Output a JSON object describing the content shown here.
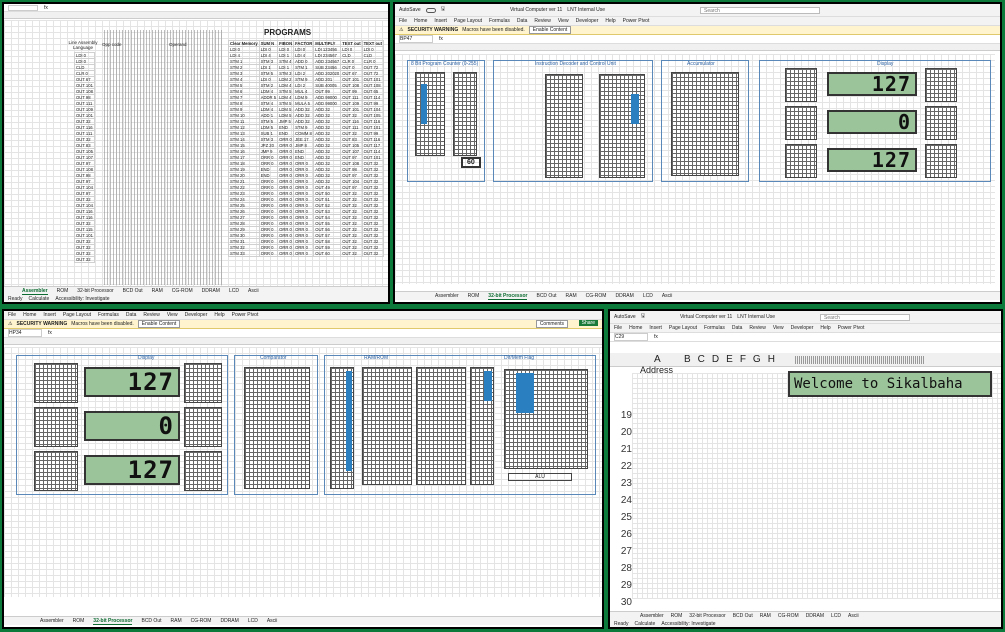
{
  "menus": [
    "File",
    "Home",
    "Insert",
    "Page Layout",
    "Formulas",
    "Data",
    "Review",
    "View",
    "Developer",
    "Help",
    "Power Pivot"
  ],
  "app_title": "Virtual Computer ver 11",
  "workbook_tag": "LNT Internal Use",
  "search_placeholder": "Search",
  "security_warning": {
    "label": "SECURITY WARNING",
    "message": "Macros have been disabled.",
    "button": "Enable Content"
  },
  "comments": "Comments",
  "share": "Share",
  "autosave": "AutoSave",
  "status_ready": "Ready",
  "status_calc": "Calculate",
  "status_access": "Accessibility: Investigate",
  "sheet_tabs": [
    "Assembler",
    "ROM",
    "32-bit Processor",
    "BCD Out",
    "RAM",
    "CG-ROM",
    "DDRAM",
    "LCD",
    "Ascii"
  ],
  "pane1": {
    "namebox": "",
    "title": "PROGRAMS",
    "headers": {
      "line": "Line",
      "asm": "Assembly Language",
      "opp": "Opp code",
      "operand": "Operand",
      "clear": "Clear Memory",
      "sum": "SUM N",
      "fibon": "FIBON",
      "factor": "FACTOR",
      "multiply": "MULTIPLY",
      "textout": "TEXT out",
      "textout2": "TEXT out"
    },
    "asm": [
      "LDI 0",
      "LDI 0",
      "CLD",
      "CLR 0",
      "OUT 67",
      "OUT 101",
      "OUT 108",
      "OUT 98",
      "OUT 111",
      "OUT 109",
      "OUT 101",
      "OUT 32",
      "OUT 116",
      "OUT 111",
      "OUT 32",
      "OUT 83",
      "OUT 105",
      "OUT 107",
      "OUT 97",
      "OUT 108",
      "OUT 98",
      "OUT 97",
      "OUT 104",
      "OUT 97",
      "OUT 32",
      "OUT 104",
      "OUT 116",
      "OUT 116",
      "OUT 32",
      "OUT 115",
      "OUT 101",
      "OUT 32",
      "OUT 32",
      "OUT 32",
      "OUT 32"
    ],
    "rows": [
      [
        "LDI 0",
        "LDI 0",
        "LDI 0",
        "LDI 0",
        "LDI 123456",
        "LDI 0",
        "LDI 0"
      ],
      [
        "LDI 4",
        "LDI 4",
        "LDI 1",
        "LDI 4",
        "LDI 234567",
        "CLD",
        "CLD"
      ],
      [
        "STM 1",
        "STM 3",
        "STM 4",
        "ADD 0",
        "ADD 234567",
        "CLR 0",
        "CLR 0"
      ],
      [
        "STM 2",
        "LDI 1",
        "LDI 1",
        "STM 1",
        "SUB 23456",
        "OUT 0",
        "OUT 72"
      ],
      [
        "STM 3",
        "STM 5",
        "STM 3",
        "LDI 2",
        "ADD 202020",
        "OUT 67",
        "OUT 72"
      ],
      [
        "STM 4",
        "LDI 0",
        "LDM 2",
        "STM 9",
        "ADD 201",
        "OUT 101",
        "OUT 101"
      ],
      [
        "STM 5",
        "STM 2",
        "LDM 4",
        "LDI 2",
        "SUB 40005",
        "OUT 108",
        "OUT 108"
      ],
      [
        "STM 6",
        "LDM 4",
        "STM 5",
        "MUL 4",
        "OUT 99",
        "OUT 99",
        "OUT 65"
      ],
      [
        "STM 7",
        "ADDR 5",
        "LDM 4",
        "LDM 9",
        "ADD 99000",
        "OUT 111",
        "OUT 114"
      ],
      [
        "STM 8",
        "STM 4",
        "STM 5",
        "MULA 5",
        "ADD 99000",
        "OUT 109",
        "OUT 99"
      ],
      [
        "STM 9",
        "LDM 4",
        "LDM 5",
        "ADD 32",
        "ADD 32",
        "OUT 101",
        "OUT 104"
      ],
      [
        "STM 10",
        "ADD 1",
        "LDM 5",
        "ADD 32",
        "ADD 32",
        "OUT 32",
        "OUT 105"
      ],
      [
        "STM 11",
        "STM 5",
        "JMP 5",
        "ADD 32",
        "ADD 32",
        "OUT 116",
        "OUT 116"
      ],
      [
        "STM 12",
        "LDM 5",
        "END",
        "STM 9",
        "ADD 32",
        "OUT 111",
        "OUT 101"
      ],
      [
        "STM 13",
        "SUB 1",
        "END",
        "COMM 8",
        "ADD 32",
        "OUT 32",
        "OUT 99"
      ],
      [
        "STM 14",
        "STM 3",
        "ORR 0",
        "JEE 17",
        "ADD 32",
        "OUT 83",
        "OUT 116"
      ],
      [
        "STM 15",
        "JPZ 20",
        "ORR 0",
        "JMP 8",
        "ADD 32",
        "OUT 105",
        "OUT 117"
      ],
      [
        "STM 16",
        "JMP 9",
        "ORR 0",
        "END",
        "ADD 32",
        "OUT 107",
        "OUT 114"
      ],
      [
        "STM 17",
        "ORR 0",
        "ORR 0",
        "END",
        "ADD 32",
        "OUT 97",
        "OUT 101"
      ],
      [
        "STM 18",
        "ORR 0",
        "ORR 0",
        "ORR 0",
        "ADD 32",
        "OUT 108",
        "OUT 32"
      ],
      [
        "STM 19",
        "END",
        "ORR 0",
        "ORR 0",
        "ADD 32",
        "OUT 98",
        "OUT 32"
      ],
      [
        "STM 20",
        "END",
        "ORR 0",
        "ORR 0",
        "ADD 32",
        "OUT 97",
        "OUT 32"
      ],
      [
        "STM 21",
        "ORR 0",
        "ORR 0",
        "ORR 0",
        "ADD 32",
        "OUT 104",
        "OUT 32"
      ],
      [
        "STM 22",
        "ORR 0",
        "ORR 0",
        "ORR 0",
        "OUT 49",
        "OUT 97",
        "OUT 32"
      ],
      [
        "STM 23",
        "ORR 0",
        "ORR 0",
        "ORR 0",
        "OUT 50",
        "OUT 32",
        "OUT 32"
      ],
      [
        "STM 24",
        "ORR 0",
        "ORR 0",
        "ORR 0",
        "OUT 51",
        "OUT 32",
        "OUT 32"
      ],
      [
        "STM 25",
        "ORR 0",
        "ORR 0",
        "ORR 0",
        "OUT 52",
        "OUT 32",
        "OUT 32"
      ],
      [
        "STM 26",
        "ORR 0",
        "ORR 0",
        "ORR 0",
        "OUT 53",
        "OUT 32",
        "OUT 32"
      ],
      [
        "STM 27",
        "ORR 0",
        "ORR 0",
        "ORR 0",
        "OUT 54",
        "OUT 32",
        "OUT 32"
      ],
      [
        "STM 28",
        "ORR 0",
        "ORR 0",
        "ORR 0",
        "OUT 55",
        "OUT 32",
        "OUT 32"
      ],
      [
        "STM 29",
        "ORR 0",
        "ORR 0",
        "ORR 0",
        "OUT 56",
        "OUT 32",
        "OUT 32"
      ],
      [
        "STM 30",
        "ORR 0",
        "ORR 0",
        "ORR 0",
        "OUT 57",
        "OUT 32",
        "OUT 32"
      ],
      [
        "STM 31",
        "ORR 0",
        "ORR 0",
        "ORR 0",
        "OUT 58",
        "OUT 32",
        "OUT 32"
      ],
      [
        "STM 32",
        "ORR 0",
        "ORR 0",
        "ORR 0",
        "OUT 59",
        "OUT 32",
        "OUT 32"
      ],
      [
        "STM 33",
        "ORR 0",
        "ORR 0",
        "ORR 0",
        "OUT 60",
        "OUT 32",
        "OUT 32"
      ]
    ]
  },
  "pane2": {
    "namebox": "BP47",
    "sections": [
      "8 Bit Program Counter (0-255)",
      "Instruction Decoder and Control Unit",
      "Accumulator",
      "Display"
    ],
    "counter": "60",
    "display": [
      "127",
      "0",
      "127"
    ]
  },
  "pane3": {
    "namebox": "HP34",
    "sections": [
      "Display",
      "Comparator",
      "RAM/ROM",
      "Dir/Mem Flag",
      "ALU"
    ],
    "display": [
      "127",
      "0",
      "127"
    ]
  },
  "pane4": {
    "namebox": "C29",
    "col_a": "A",
    "address_label": "Address",
    "cols": [
      "B",
      "C",
      "D",
      "E",
      "F",
      "G",
      "H"
    ],
    "rows": [
      "19",
      "20",
      "21",
      "22",
      "23",
      "24",
      "25",
      "26",
      "27",
      "28",
      "29",
      "30"
    ],
    "lcd_text": "Welcome to Sikalbaha"
  }
}
